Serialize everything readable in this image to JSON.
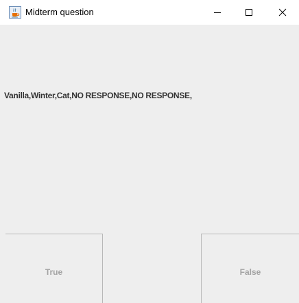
{
  "window": {
    "title": "Midterm question",
    "icon": "java-cup-icon",
    "controls": {
      "minimize": "minimize-icon",
      "maximize": "maximize-icon",
      "close": "close-icon"
    }
  },
  "content": {
    "message": "Vanilla,Winter,Cat,NO RESPONSE,NO RESPONSE,"
  },
  "buttons": {
    "true_label": "True",
    "false_label": "False"
  },
  "colors": {
    "client_background": "#eeeeee",
    "button_text": "#a3a3a3",
    "message_text": "#333333"
  }
}
